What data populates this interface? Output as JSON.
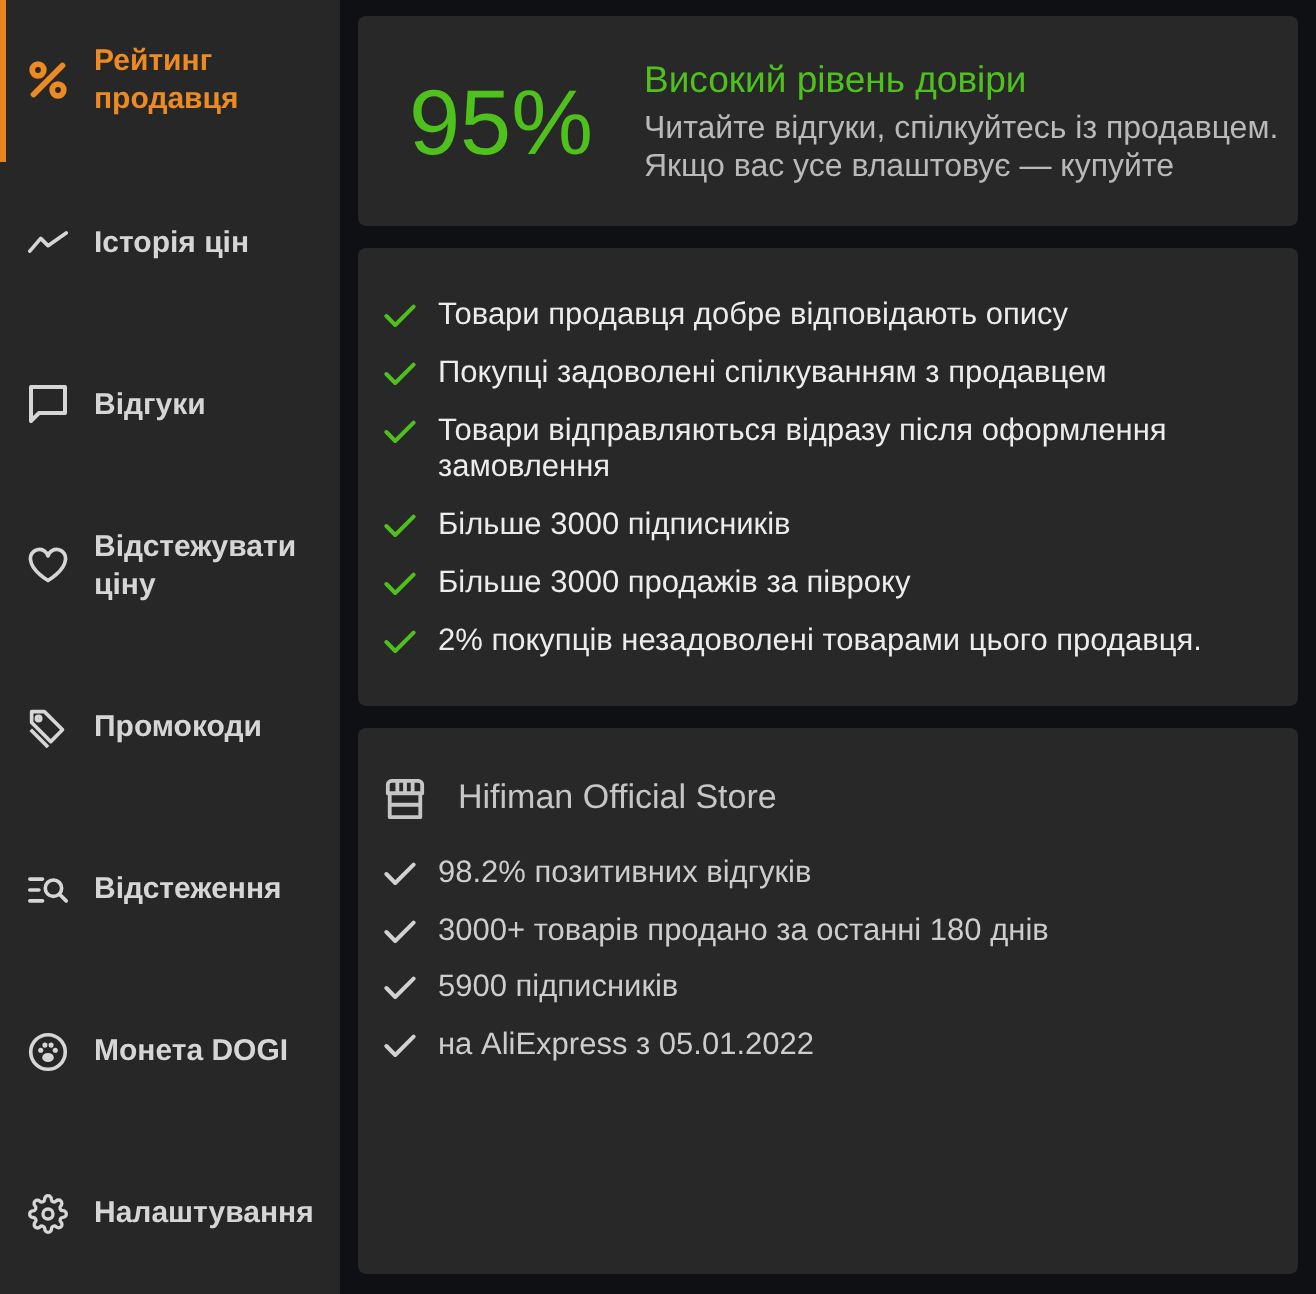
{
  "sidebar": {
    "items": [
      {
        "label": "Рейтинг продавця",
        "selected": true
      },
      {
        "label": "Історія цін",
        "selected": false
      },
      {
        "label": "Відгуки",
        "selected": false
      },
      {
        "label": "Відстежувати ціну",
        "selected": false
      },
      {
        "label": "Промокоди",
        "selected": false
      },
      {
        "label": "Відстеження",
        "selected": false
      },
      {
        "label": "Монета DOGI",
        "selected": false
      },
      {
        "label": "Налаштування",
        "selected": false
      }
    ]
  },
  "rating": {
    "score": "95%",
    "heading": "Високий рівень довіри",
    "description": "Читайте відгуки, спілкуйтесь із продавцем. Якщо вас усе влаштовує — купуйте"
  },
  "highlights": [
    "Товари продавця добре відповідають опису",
    "Покупці задоволені спілкуванням з продавцем",
    "Товари відправляються відразу після оформлення замовлення",
    "Більше 3000 підписників",
    "Більше 3000 продажів за півроку",
    "2% покупців незадоволені товарами цього продавця."
  ],
  "store": {
    "name": "Hifiman Official Store",
    "facts": [
      "98.2% позитивних відгуків",
      "3000+ товарів продано за останні 180 днів",
      "5900 підписників",
      "на AliExpress з 05.01.2022"
    ]
  }
}
